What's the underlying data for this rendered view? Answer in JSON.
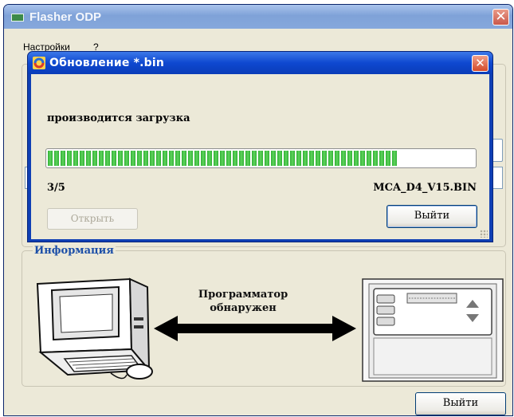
{
  "main_window": {
    "title": "Flasher ODP",
    "close_glyph": "✕",
    "menu": [
      "Настройки",
      "?"
    ],
    "info_group_label": "Информация",
    "illustration_caption": {
      "line1": "Программатор",
      "line2": "обнаружен"
    },
    "exit_label": "Выйти"
  },
  "dialog": {
    "title": "Обновление *.bin",
    "close_glyph": "✕",
    "status": "производится загрузка",
    "progress_fraction": 0.82,
    "step": "3/5",
    "file": "MCA_D4_V15.BIN",
    "open_label": "Открыть",
    "exit_label": "Выйти"
  },
  "icons": {
    "app": "flasher-app-icon",
    "dialog": "update-icon",
    "computer": "computer-icon",
    "arrow": "double-arrow-icon",
    "device": "controller-device-icon"
  },
  "colors": {
    "progress_green": "#2fb033",
    "dialog_titlebar": "#0e48d0",
    "info_label": "#1c4fa8"
  }
}
